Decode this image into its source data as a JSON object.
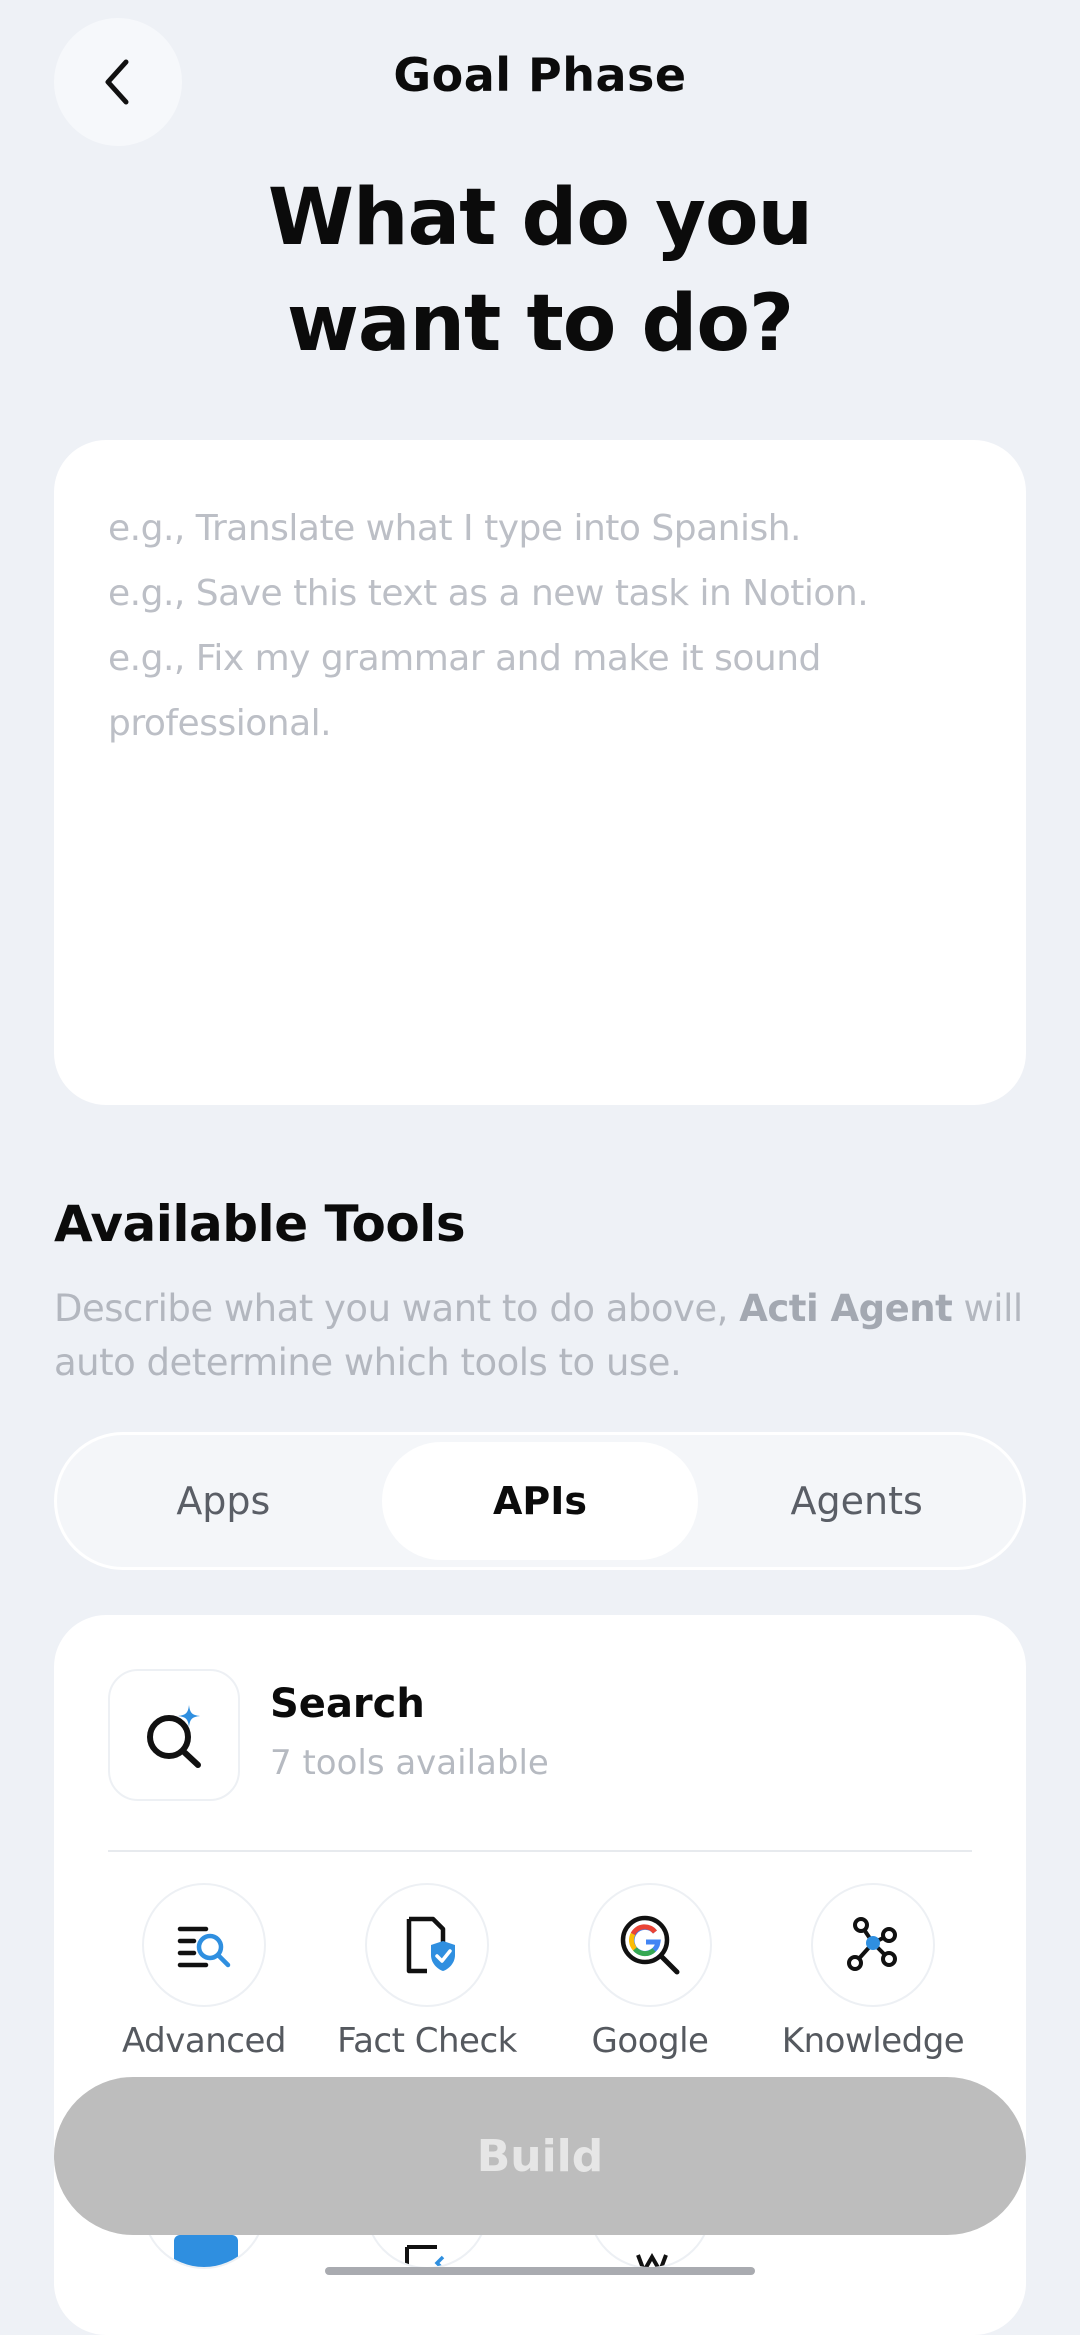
{
  "header": {
    "title": "Goal Phase",
    "back_icon": "chevron-left-icon"
  },
  "main": {
    "title": "What do you want to do?",
    "goal_input": {
      "value": "",
      "placeholder": "e.g., Translate what I type into Spanish.\ne.g., Save this text as a new task in Notion.\ne.g., Fix my grammar and make it sound professional."
    }
  },
  "tools": {
    "title": "Available Tools",
    "desc_prefix": "Describe what you want to do above, ",
    "desc_brand": "Acti Agent",
    "desc_suffix": " will auto determine which tools to use.",
    "tabs": [
      {
        "label": "Apps",
        "active": false
      },
      {
        "label": "APIs",
        "active": true
      },
      {
        "label": "Agents",
        "active": false
      }
    ],
    "category": {
      "name": "Search",
      "count": "7 tools available",
      "icon": "search-sparkle-icon",
      "items": [
        {
          "label": "Advanced",
          "icon": "advanced-search-icon"
        },
        {
          "label": "Fact Check",
          "icon": "fact-check-icon"
        },
        {
          "label": "Google",
          "icon": "google-search-icon"
        },
        {
          "label": "Knowledge",
          "icon": "knowledge-graph-icon"
        }
      ]
    }
  },
  "build_button": {
    "label": "Build",
    "enabled": false
  },
  "colors": {
    "accent_blue": "#2f8fe0",
    "disabled_button": "#bdbdbd",
    "background": "#eef1f6"
  }
}
